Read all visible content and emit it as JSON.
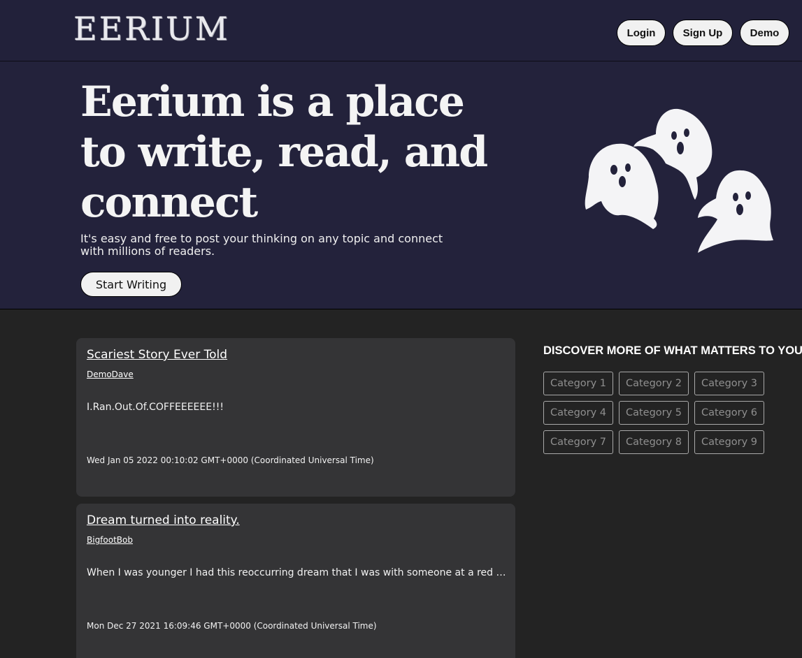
{
  "header": {
    "logo": "EERIUM",
    "login_label": "Login",
    "signup_label": "Sign Up",
    "demo_label": "Demo"
  },
  "hero": {
    "title": "Eerium is a place to write, read, and connect",
    "subtitle": "It's easy and free to post your thinking on any topic and connect with millions of readers.",
    "cta_label": "Start Writing",
    "illustration": "ghosts-icon"
  },
  "stories": [
    {
      "title": "Scariest Story Ever Told",
      "author": "DemoDave",
      "excerpt": "I.Ran.Out.Of.COFFEEEEEE!!!",
      "date": "Wed Jan 05 2022 00:10:02 GMT+0000 (Coordinated Universal Time)"
    },
    {
      "title": "Dream turned into reality.",
      "author": "BigfootBob",
      "excerpt": "When I was younger I had this reoccurring dream that I was with someone at a red light and I was going to be in a car accident",
      "date": "Mon Dec 27 2021 16:09:46 GMT+0000 (Coordinated Universal Time)"
    }
  ],
  "sidebar": {
    "heading": "DISCOVER MORE OF WHAT MATTERS TO YOU",
    "categories": [
      "Category 1",
      "Category 2",
      "Category 3",
      "Category 4",
      "Category 5",
      "Category 6",
      "Category 7",
      "Category 8",
      "Category 9"
    ]
  },
  "colors": {
    "header_bg": "#22213a",
    "hero_bg": "#23223b",
    "page_bg": "#232323",
    "card_bg": "#343436",
    "button_bg": "#f1f1f1"
  }
}
